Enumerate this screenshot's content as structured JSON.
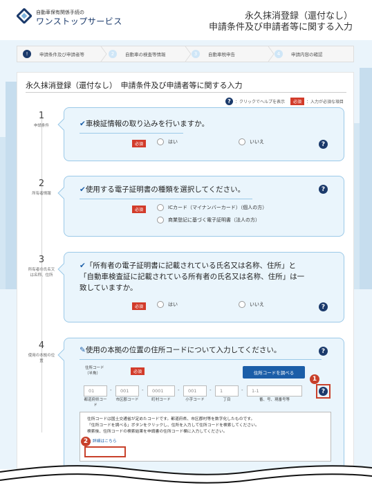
{
  "header": {
    "logo_sub": "自動車保有関係手続の",
    "logo_main": "ワンストップサービス",
    "title_line1": "永久抹消登録（還付なし）",
    "title_line2": "申請条件及び申請者等に関する入力"
  },
  "steps": [
    {
      "num": "!",
      "label": "申請条件及び申請者等"
    },
    {
      "num": "2",
      "label": "自動車の検査等情報"
    },
    {
      "num": "3",
      "label": "自動車税申告"
    },
    {
      "num": "4",
      "label": "申請内容の確認"
    }
  ],
  "page": {
    "title": "永久抹消登録（還付なし）　申請条件及び申請者等に関する入力",
    "help_text": "：クリックでヘルプを表示",
    "required_text": "：入力が必須な項目",
    "required_badge": "必須"
  },
  "sections": [
    {
      "num": "1",
      "label": "申請条件",
      "question": "車検証情報の取り込みを行いますか。",
      "options": [
        "はい",
        "いいえ"
      ]
    },
    {
      "num": "2",
      "label": "所有者情報",
      "question": "使用する電子証明書の種類を選択してください。",
      "options": [
        "ICカード（マイナンバーカード）（個人の方）",
        "商業登記に基づく電子証明書（法人の方）"
      ]
    },
    {
      "num": "3",
      "label": "所有者の氏名又は名称、住所",
      "question_line1": "「所有者の電子証明書に記載されている氏名又は名称、住所」と",
      "question_line2": "「自動車検査証に記載されている所有者の氏名又は名称、住所」は一",
      "question_line3": "致していますか。",
      "options": [
        "はい",
        "いいえ"
      ]
    },
    {
      "num": "4",
      "label": "使用の本拠の位置",
      "question": "使用の本拠の位置の住所コードについて入力してください。"
    }
  ],
  "address": {
    "code_label": "住所コード（半角）",
    "search_button": "住所コードを調べる",
    "fields": [
      {
        "value": "01",
        "label": "都道府県コード"
      },
      {
        "value": "001",
        "label": "市区郡コード"
      },
      {
        "value": "0001",
        "label": "町村コード"
      },
      {
        "value": "001",
        "label": "小字コード"
      },
      {
        "value": "1",
        "label": "丁目"
      },
      {
        "value": "1-1",
        "label": "番、号、現番号等"
      }
    ],
    "info_line1": "住所コードは国土交通省が定めたコードです。都道府県、市区郡村等を数字化したものです。",
    "info_line2": "「住所コードを調べる」ボタンをクリックし、住所を入力して住所コードを検索してください。",
    "info_line3": "検索後、住所コードの検索結果を申請書の住所コード欄に入力してください。",
    "detail_link": "詳細はこちら"
  },
  "callouts": [
    "1",
    "2"
  ],
  "colors": {
    "navy": "#1b3a6b",
    "accent": "#1b5ea8",
    "required": "#d23b2a",
    "card_bg": "#eaf5fc"
  }
}
